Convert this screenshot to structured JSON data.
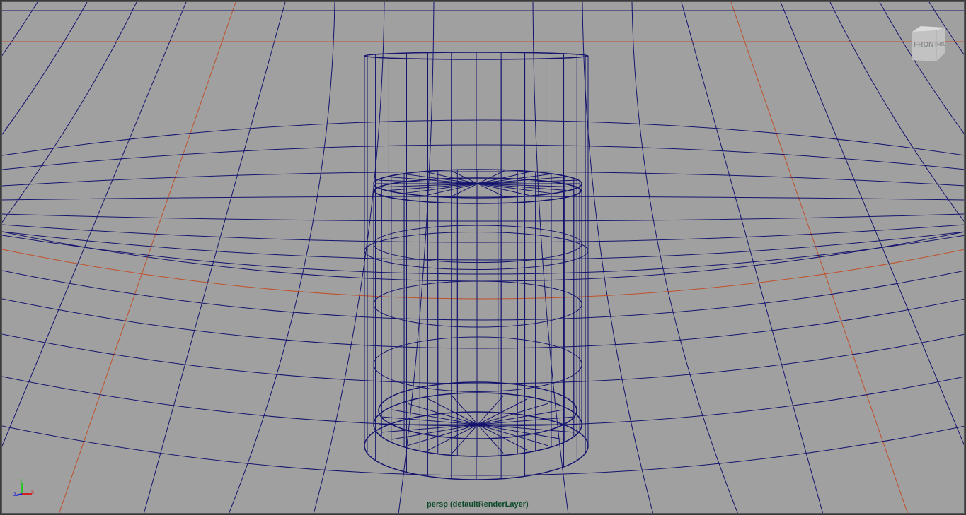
{
  "viewport": {
    "camera_label": "persp (defaultRenderLayer)",
    "viewcube_face": "FRONT",
    "viewcube_side": "RIGHT",
    "axis_labels": {
      "x": "x",
      "y": "y",
      "z": "z"
    }
  },
  "colors": {
    "background": "#a0a0a0",
    "wire": "#14146e",
    "grid_axis": "#c0502a"
  }
}
